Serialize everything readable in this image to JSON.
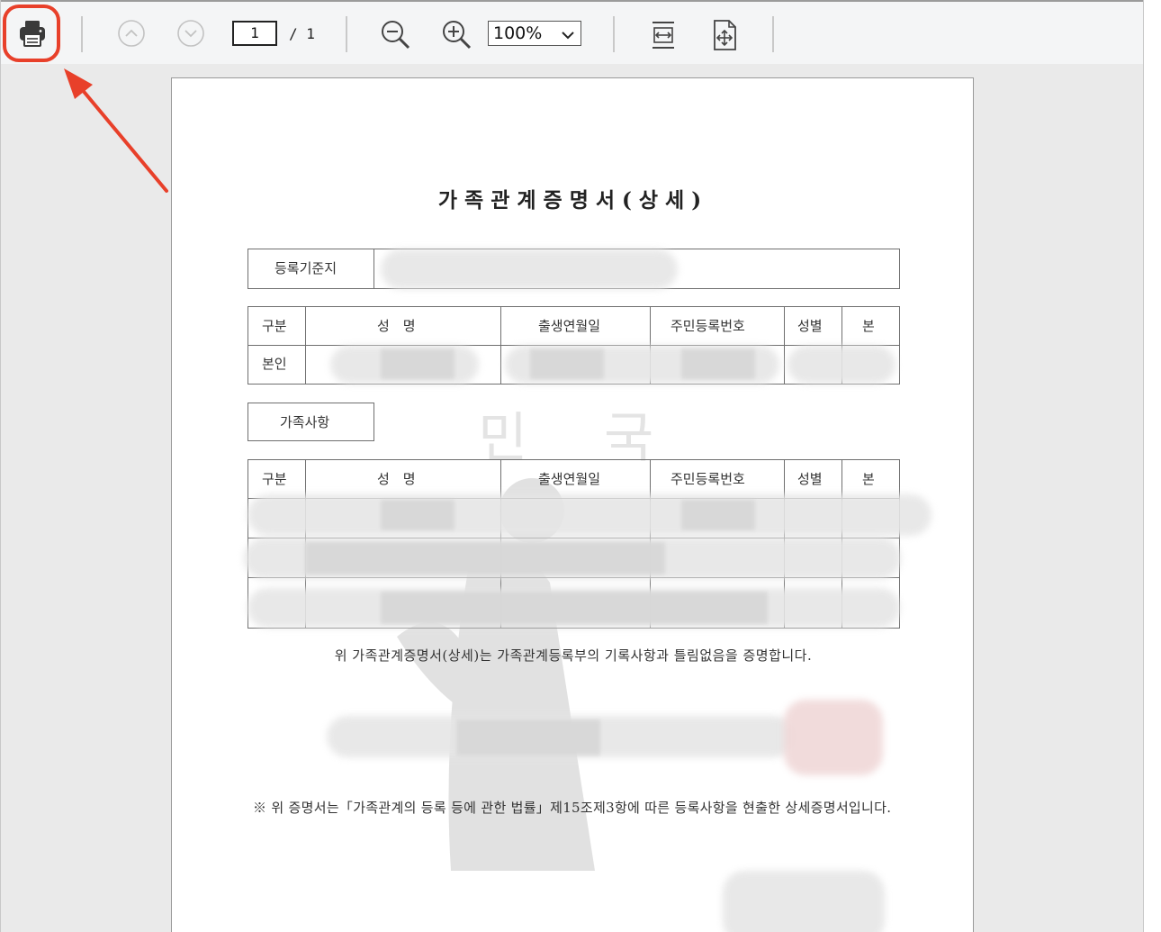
{
  "toolbar": {
    "page_current": "1",
    "page_total": "/ 1",
    "zoom_value": "100%",
    "icons": {
      "print": "printer-icon",
      "prev": "chevron-up-circle-icon",
      "next": "chevron-down-circle-icon",
      "zoom_out": "zoom-out-icon",
      "zoom_in": "zoom-in-icon",
      "fit_width": "fit-width-icon",
      "fit_page": "fit-page-icon"
    },
    "highlight_color": "#e8402a"
  },
  "document": {
    "title": "가족관계증명서(상세)",
    "registration_label": "등록기준지",
    "self_table": {
      "headers": [
        "구분",
        "성　명",
        "출생연월일",
        "주민등록번호",
        "성별",
        "본"
      ],
      "row_label": "본인"
    },
    "family_label": "가족사항",
    "family_table": {
      "headers": [
        "구분",
        "성　명",
        "출생연월일",
        "주민등록번호",
        "성별",
        "본"
      ]
    },
    "statement": "위 가족관계증명서(상세)는 가족관계등록부의 기록사항과 틀림없음을 증명합니다.",
    "note": "※ 위 증명서는「가족관계의 등록 등에 관한 법률」제15조제3항에 따른 등록사항을 현출한 상세증명서입니다."
  }
}
